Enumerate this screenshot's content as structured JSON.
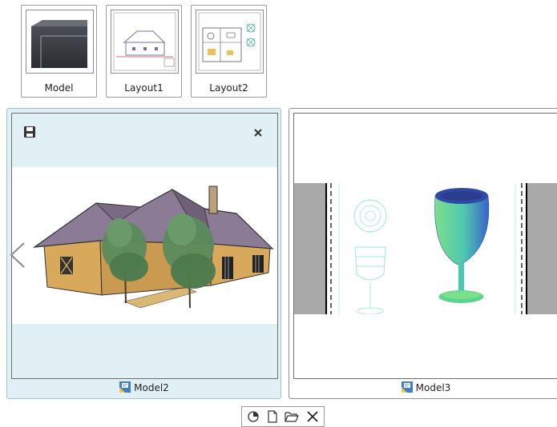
{
  "tiles": [
    {
      "label": "Model",
      "icon": "model-space-icon"
    },
    {
      "label": "Layout1",
      "icon": "layout-sheet-icon"
    },
    {
      "label": "Layout2",
      "icon": "layout-sheet-icon"
    }
  ],
  "previews": [
    {
      "label": "Model2",
      "icon": "drawing-file-icon",
      "content": "house-with-trees-render"
    },
    {
      "label": "Model3",
      "icon": "drawing-file-icon",
      "content": "wine-glass-render"
    }
  ],
  "toolbar": {
    "icons": [
      "pin-icon",
      "new-document-icon",
      "open-folder-icon",
      "close-icon"
    ]
  },
  "colors": {
    "selected_panel_bg": "#e1f0f4",
    "selected_panel_border": "#9cc5d0",
    "roof": "#8c7b95",
    "walls": "#d8a95a",
    "glass": "#57c8a0"
  }
}
